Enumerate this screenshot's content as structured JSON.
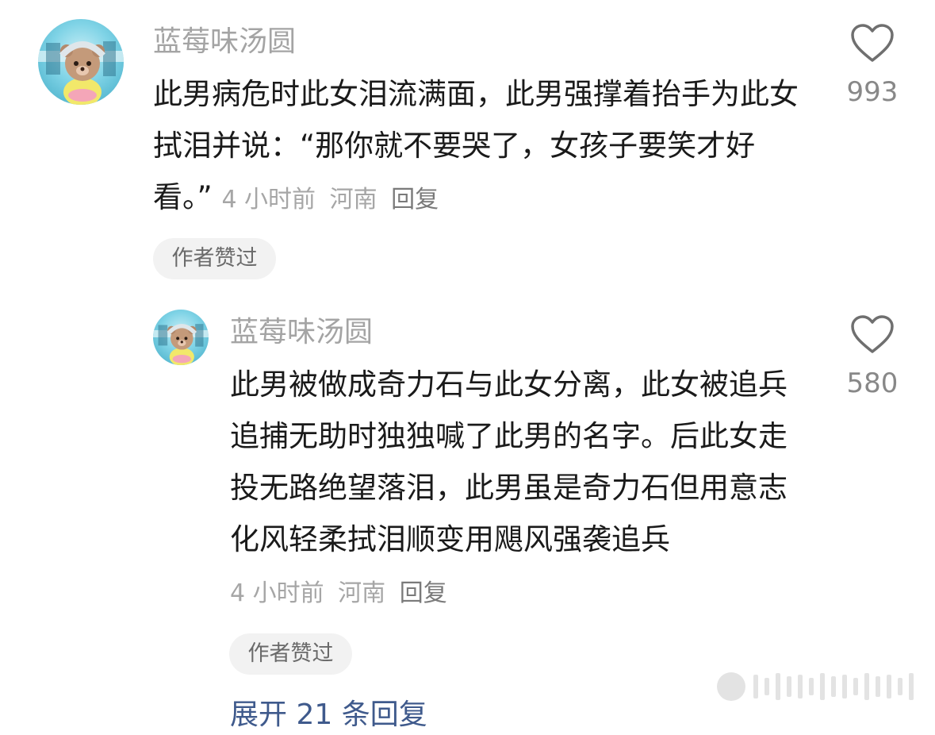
{
  "comment": {
    "username": "蓝莓味汤圆",
    "text": "此男病危时此女泪流满面，此男强撑着抬手为此女拭泪并说：“那你就不要哭了，女孩子要笑才好看。”",
    "time": "4 小时前",
    "location": "河南",
    "reply_label": "回复",
    "likes": "993",
    "author_badge": "作者赞过"
  },
  "reply": {
    "username": "蓝莓味汤圆",
    "text": "此男被做成奇力石与此女分离，此女被追兵追捕无助时独独喊了此男的名字。后此女走投无路绝望落泪，此男虽是奇力石但用意志化风轻柔拭泪顺变用飓风强袭追兵",
    "time": "4 小时前",
    "location": "河南",
    "reply_label": "回复",
    "likes": "580",
    "author_badge": "作者赞过"
  },
  "expand_label": "展开 21 条回复",
  "colors": {
    "username": "#a4a4a4",
    "meta": "#a6a6a6",
    "link": "#3f5a8c",
    "badge_bg": "#f2f2f2"
  }
}
